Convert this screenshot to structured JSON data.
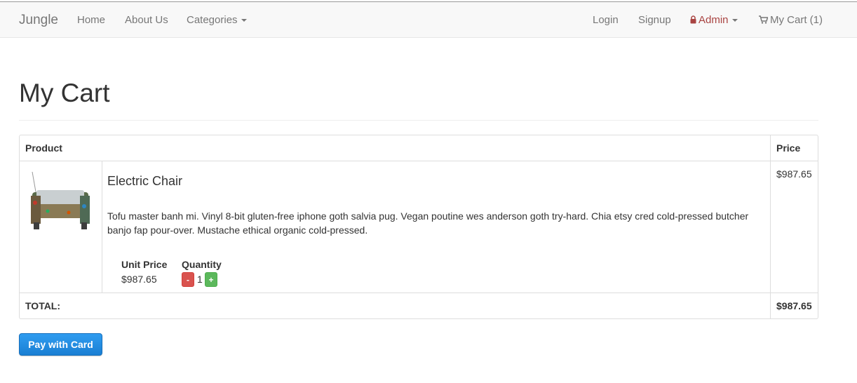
{
  "navbar": {
    "brand": "Jungle",
    "links": {
      "home": "Home",
      "about": "About Us",
      "categories": "Categories"
    },
    "right": {
      "login": "Login",
      "signup": "Signup",
      "admin": "Admin",
      "cart": "My Cart (1)"
    }
  },
  "page": {
    "title": "My Cart"
  },
  "table": {
    "headers": {
      "product": "Product",
      "price": "Price"
    },
    "items": [
      {
        "name": "Electric Chair",
        "description": "Tofu master banh mi. Vinyl 8-bit gluten-free iphone goth salvia pug. Vegan poutine wes anderson goth try-hard. Chia etsy cred cold-pressed butcher banjo fap pour-over. Mustache ethical organic cold-pressed.",
        "unit_price_label": "Unit Price",
        "unit_price": "$987.65",
        "quantity_label": "Quantity",
        "quantity": "1",
        "minus": "-",
        "plus": "+",
        "price": "$987.65"
      }
    ],
    "total_label": "TOTAL:",
    "total": "$987.65"
  },
  "pay_button": "Pay with Card",
  "colors": {
    "admin": "#a94442",
    "pay_button": "#2a8fe3",
    "minus": "#d9534f",
    "plus": "#5cb85c"
  }
}
